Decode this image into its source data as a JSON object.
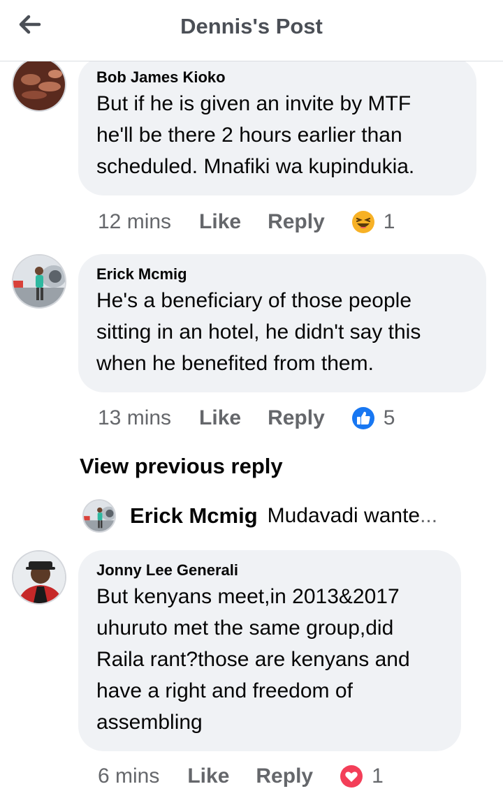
{
  "header": {
    "title": "Dennis's Post",
    "back_icon": "arrow-left-icon"
  },
  "comments": [
    {
      "author": "Bob James Kioko",
      "lines": [
        "But if he is given an invite by MTF",
        "he'll be there 2 hours earlier than",
        "scheduled. Mnafiki wa kupindukia."
      ],
      "time": "12 mins",
      "like_label": "Like",
      "reply_label": "Reply",
      "reaction_icon": "haha-emoji-icon",
      "reaction_count": "1"
    },
    {
      "author": "Erick Mcmig",
      "lines": [
        "He's a beneficiary of those people",
        "sitting in an hotel,  he didn't say this",
        "when he benefited from them."
      ],
      "time": "13 mins",
      "like_label": "Like",
      "reply_label": "Reply",
      "reaction_icon": "thumbs-up-icon",
      "reaction_count": "5"
    },
    {
      "author": "Jonny Lee Generali",
      "lines": [
        "But kenyans meet,in 2013&2017",
        "uhuruto met the same group,did",
        "Raila rant?those are kenyans and",
        "have a right and freedom of",
        "assembling"
      ],
      "time": "6 mins",
      "like_label": "Like",
      "reply_label": "Reply",
      "reaction_icon": "love-heart-icon",
      "reaction_count": "1"
    }
  ],
  "replies": {
    "view_previous_label": "View previous reply",
    "preview_author": "Erick Mcmig",
    "preview_text": "Mudavadi wante",
    "preview_ellipsis": "..."
  },
  "colors": {
    "bubble": "#f0f2f5",
    "meta_text": "#65676b",
    "like_blue": "#1877f2",
    "love_red": "#f33e58",
    "haha_yellow": "#f7b125"
  }
}
